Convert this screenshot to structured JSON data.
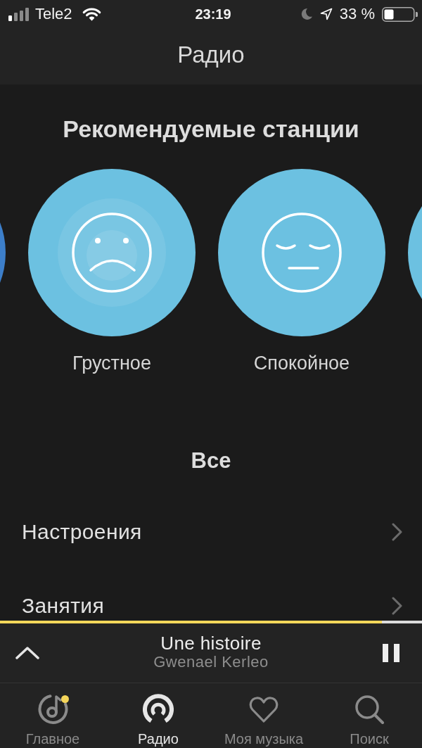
{
  "status_bar": {
    "carrier": "Tele2",
    "time": "23:19",
    "battery": "33 %"
  },
  "header": {
    "title": "Радио"
  },
  "featured": {
    "title": "Рекомендуемые станции",
    "stations": [
      {
        "kind": "edge",
        "color": "#3d7fca"
      },
      {
        "kind": "sad",
        "label": "Грустное",
        "color": "#6cc1e1",
        "playing": true
      },
      {
        "kind": "calm",
        "label": "Спокойное",
        "color": "#6cc1e1",
        "playing": false
      },
      {
        "kind": "edge",
        "color": "#6cc1e1"
      }
    ]
  },
  "all_stations": {
    "title": "Все",
    "items": [
      {
        "label": "Настроения"
      },
      {
        "label": "Занятия"
      }
    ]
  },
  "player": {
    "title": "Une histoire",
    "artist": "Gwenael Kerleo",
    "level": 0.905,
    "playing": true
  },
  "tabs": [
    {
      "label": "Главное",
      "selected": false,
      "badge": true
    },
    {
      "label": "Радио",
      "selected": true,
      "badge": false
    },
    {
      "label": "Моя музыка",
      "selected": false,
      "badge": false
    },
    {
      "label": "Поиск",
      "selected": false,
      "badge": false
    }
  ]
}
